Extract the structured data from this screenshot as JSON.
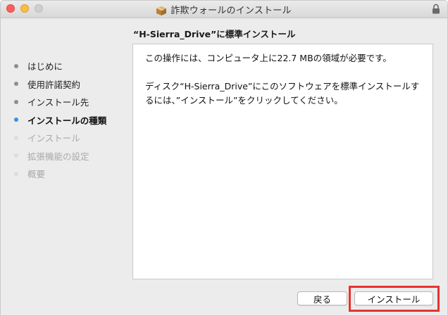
{
  "window": {
    "title": "詐欺ウォールのインストール",
    "icons": {
      "title": "package-icon",
      "lock": "lock-icon"
    },
    "traffic_lights": [
      "close",
      "minimize",
      "zoom"
    ]
  },
  "header": {
    "page_title": "“H-Sierra_Drive”に標準インストール"
  },
  "sidebar": {
    "steps": [
      {
        "label": "はじめに",
        "state": "done"
      },
      {
        "label": "使用許諾契約",
        "state": "done"
      },
      {
        "label": "インストール先",
        "state": "done"
      },
      {
        "label": "インストールの種類",
        "state": "active"
      },
      {
        "label": "インストール",
        "state": "future"
      },
      {
        "label": "拡張機能の設定",
        "state": "future"
      },
      {
        "label": "概要",
        "state": "future"
      }
    ]
  },
  "content": {
    "message_1": "この操作には、コンピュータ上に22.7 MBの領域が必要です。",
    "message_2": "ディスク“H-Sierra_Drive”にこのソフトウェアを標準インストールするには、”インストール”をクリックしてください。"
  },
  "buttons": {
    "back_label": "戻る",
    "install_label": "インストール"
  },
  "colors": {
    "active_step_dot": "#3b8fe0",
    "highlight": "#e8322f",
    "close": "#fc605c",
    "minimize": "#fdbc40"
  }
}
